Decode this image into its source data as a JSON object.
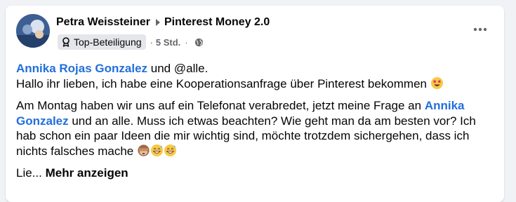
{
  "post": {
    "author": "Petra Weissteiner",
    "group": "Pinterest Money 2.0",
    "badge": "Top-Beteiligung",
    "separator": "·",
    "time": "5 Std.",
    "paragraph1": {
      "mention": "Annika Rojas Gonzalez",
      "text_after_mention": " und @alle.",
      "line2": "Hallo ihr lieben, ich habe eine Kooperationsanfrage über Pinterest bekommen "
    },
    "paragraph2": {
      "text_before_mention": "Am Montag haben wir uns auf ein Telefonat verabredet, jetzt meine Frage an ",
      "mention": "Annika Gonzalez",
      "text_after_mention": " und an alle. Muss ich etwas beachten? Wie geht man da am besten vor? Ich hab schon ein paar Ideen die mir wichtig sind, möchte trotzdem sichergehen, dass ich nichts falsches mache "
    },
    "truncated_text": "Lie...",
    "see_more": "Mehr anzeigen"
  },
  "icons": {
    "author_arrow": "caret-right-icon",
    "badge": "award-ribbon-icon",
    "audience": "globe-icon",
    "more": "more-dots-icon",
    "emoji_star_struck": "star-struck-emoji",
    "emoji_see_no_evil": "see-no-evil-monkey-emoji",
    "emoji_grinning_sweat": "grinning-sweat-emoji"
  },
  "colors": {
    "mention": "#216fdb",
    "secondary_text": "#65676b",
    "badge_bg": "#e4e6eb"
  }
}
